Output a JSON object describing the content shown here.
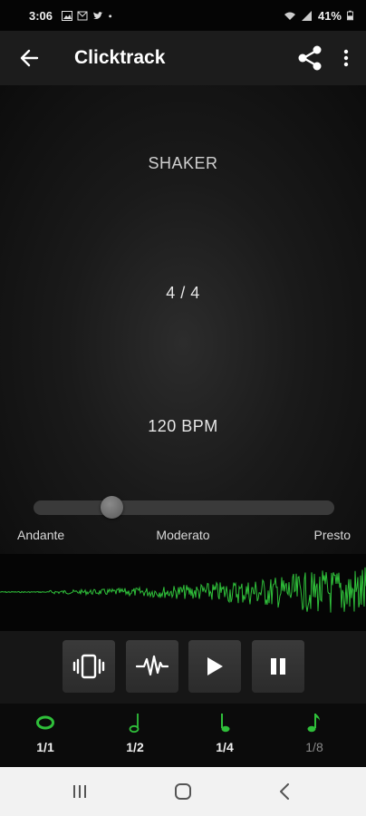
{
  "status_bar": {
    "time": "3:06",
    "battery": "41%",
    "icons": [
      "gallery-icon",
      "gmail-icon",
      "twitter-icon",
      "dot-icon",
      "wifi-icon",
      "signal-icon",
      "battery-icon"
    ]
  },
  "app_bar": {
    "title": "Clicktrack",
    "icons": [
      "back-arrow-icon",
      "share-icon",
      "more-vert-icon"
    ]
  },
  "main": {
    "sound": "SHAKER",
    "time_signature": "4 / 4",
    "bpm": "120 BPM",
    "tempo_slider": {
      "value_fraction": 0.26,
      "labels": [
        "Andante",
        "Moderato",
        "Presto"
      ]
    }
  },
  "controls": {
    "buttons": [
      "vibrate-icon",
      "waveform-icon",
      "play-icon",
      "pause-icon"
    ]
  },
  "note_values": [
    {
      "label": "1/1",
      "icon": "whole-note-icon",
      "active": true
    },
    {
      "label": "1/2",
      "icon": "half-note-icon",
      "active": true
    },
    {
      "label": "1/4",
      "icon": "quarter-note-icon",
      "active": true
    },
    {
      "label": "1/8",
      "icon": "eighth-note-icon",
      "active": false
    }
  ],
  "colors": {
    "accent_green": "#2fbf3a",
    "app_bar": "#1c1c1c",
    "background": "#0a0a0a"
  },
  "system_nav": {
    "icons": [
      "recents-icon",
      "home-icon",
      "back-nav-icon"
    ]
  }
}
